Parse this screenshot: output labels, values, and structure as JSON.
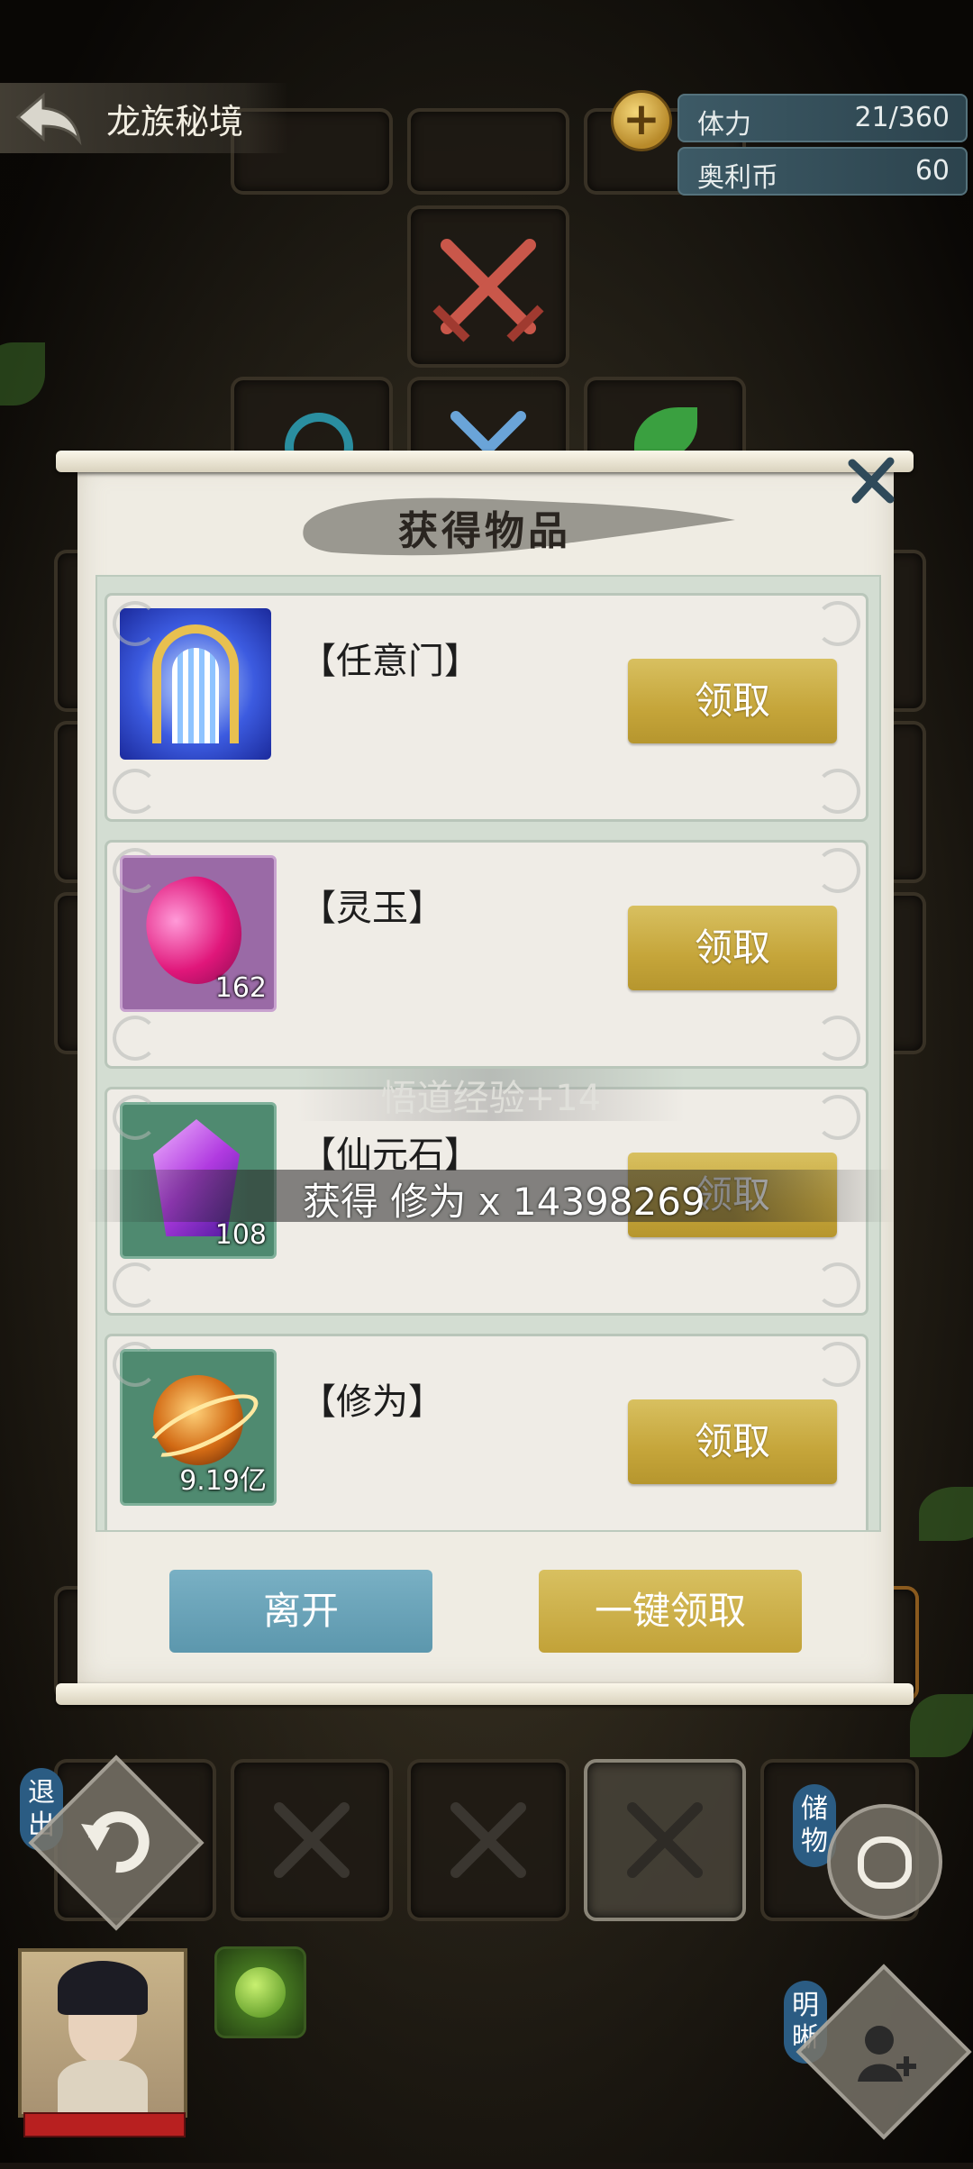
{
  "header": {
    "title": "龙族秘境",
    "stats": [
      {
        "label": "体力",
        "value": "21/360"
      },
      {
        "label": "奥利币",
        "value": "60"
      }
    ]
  },
  "dialog": {
    "title": "获得物品",
    "items": [
      {
        "name": "【任意门】",
        "count": "",
        "icon": "golden-gate-icon",
        "claim_label": "领取"
      },
      {
        "name": "【灵玉】",
        "count": "162",
        "icon": "pink-jade-icon",
        "claim_label": "领取"
      },
      {
        "name": "【仙元石】",
        "count": "108",
        "icon": "purple-crystal-icon",
        "claim_label": "领取"
      },
      {
        "name": "【修为】",
        "count": "9.19亿",
        "icon": "cultivation-orb-icon",
        "claim_label": "领取"
      }
    ],
    "leave_label": "离开",
    "claim_all_label": "一键领取"
  },
  "floating": {
    "exp_text": "悟道经验+14",
    "gain_text": "获得 修为 x 14398269"
  },
  "controls": {
    "exit_label": "退出",
    "storage_label": "储物",
    "clarity_label": "明晰"
  },
  "colors": {
    "claim_gold": "#c5a53a",
    "leave_blue": "#5c97ad",
    "stat_bg": "#3d5a66",
    "hp_red": "#b82020"
  }
}
